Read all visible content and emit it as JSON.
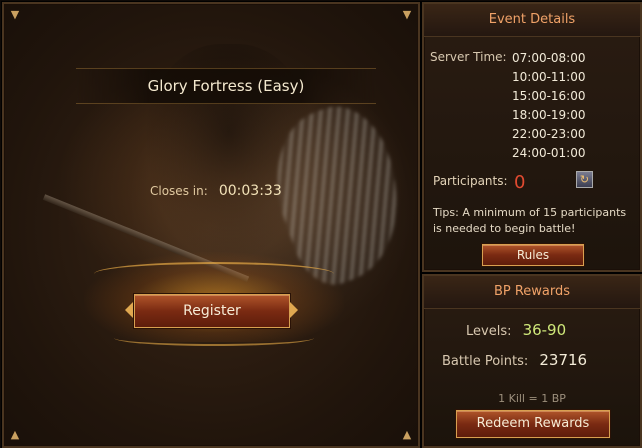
{
  "event": {
    "title": "Glory Fortress (Easy)",
    "closes_label": "Closes in:",
    "closes_value": "00:03:33",
    "register_label": "Register"
  },
  "details": {
    "title": "Event Details",
    "server_time_label": "Server Time:",
    "times": [
      "07:00-08:00",
      "10:00-11:00",
      "15:00-16:00",
      "18:00-19:00",
      "22:00-23:00",
      "24:00-01:00"
    ],
    "participants_label": "Participants:",
    "participants_value": "0",
    "tips": "Tips: A minimum of 15 participants is needed to begin battle!",
    "rules_label": "Rules"
  },
  "rewards": {
    "title": "BP Rewards",
    "levels_label": "Levels:",
    "levels_value": "36-90",
    "battle_points_label": "Battle Points:",
    "battle_points_value": "23716",
    "kill_note": "1 Kill = 1 BP",
    "redeem_label": "Redeem Rewards"
  },
  "icons": {
    "corner": "chevron-down-icon",
    "refresh": "refresh-icon"
  },
  "colors": {
    "accent_title": "#f0a268",
    "participants": "#e04a30",
    "levels": "#cfe87a",
    "button": "#7a2a12"
  }
}
